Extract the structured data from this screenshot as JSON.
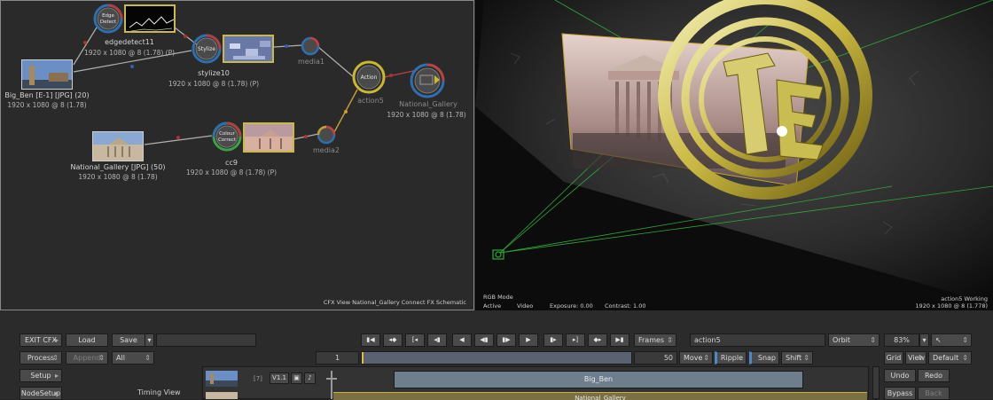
{
  "schematic": {
    "footer": "CFX View National_Gallery Connect FX Schematic",
    "nodes": {
      "edgedetect": {
        "icon_label_1": "Edge",
        "icon_label_2": "Detect",
        "name": "edgedetect11",
        "res": "1920 x 1080 @ 8 (1.78) (P)"
      },
      "bigben": {
        "name": "Big_Ben [E-1] [JPG] (20)",
        "res": "1920 x 1080 @ 8 (1.78)"
      },
      "stylize": {
        "icon_label": "Stylize",
        "name": "stylize10",
        "res": "1920 x 1080 @ 8 (1.78) (P)"
      },
      "media1": {
        "name": "media1"
      },
      "action": {
        "icon_label": "Action",
        "name": "action5"
      },
      "output": {
        "name": "National_Gallery",
        "res": "1920 x 1080 @ 8 (1.78)"
      },
      "national": {
        "name": "National_Gallery [JPG] (50)",
        "res": "1920 x 1080 @ 8 (1.78)"
      },
      "cc": {
        "icon_label_1": "Colour",
        "icon_label_2": "Correct",
        "name": "cc9",
        "res": "1920 x 1080 @ 8 (1.78) (P)"
      },
      "media2": {
        "name": "media2"
      }
    }
  },
  "viewer": {
    "rgb_mode": "RGB Mode",
    "active": "Active",
    "video": "Video",
    "exposure": "Exposure: 0.00",
    "contrast": "Contrast: 1.00",
    "working": "action5 Working",
    "res": "1920 x 1080 @ 8 (1.778)"
  },
  "controls": {
    "exit_cfx": "EXIT CFX",
    "load": "Load",
    "save": "Save",
    "process": "Process",
    "append": "Append",
    "all": "All",
    "setup": "Setup",
    "node_setup": "NodeSetup",
    "timing_view": "Timing View",
    "frames": "Frames",
    "node_name": "action5",
    "orbit": "Orbit",
    "zoom": "83%",
    "start_frame": "1",
    "end_frame": "50",
    "move": "Move",
    "ripple": "Ripple",
    "snap": "Snap",
    "shift": "Shift",
    "grid": "Grid",
    "view": "View",
    "default": "Default",
    "undo": "Undo",
    "redo": "Redo",
    "bypass": "Bypass",
    "back": "Back",
    "track1": {
      "num": "[7]",
      "version": "V1.1",
      "clip": "Big_Ben"
    },
    "track2": {
      "clip": "National_Gallery"
    }
  }
}
